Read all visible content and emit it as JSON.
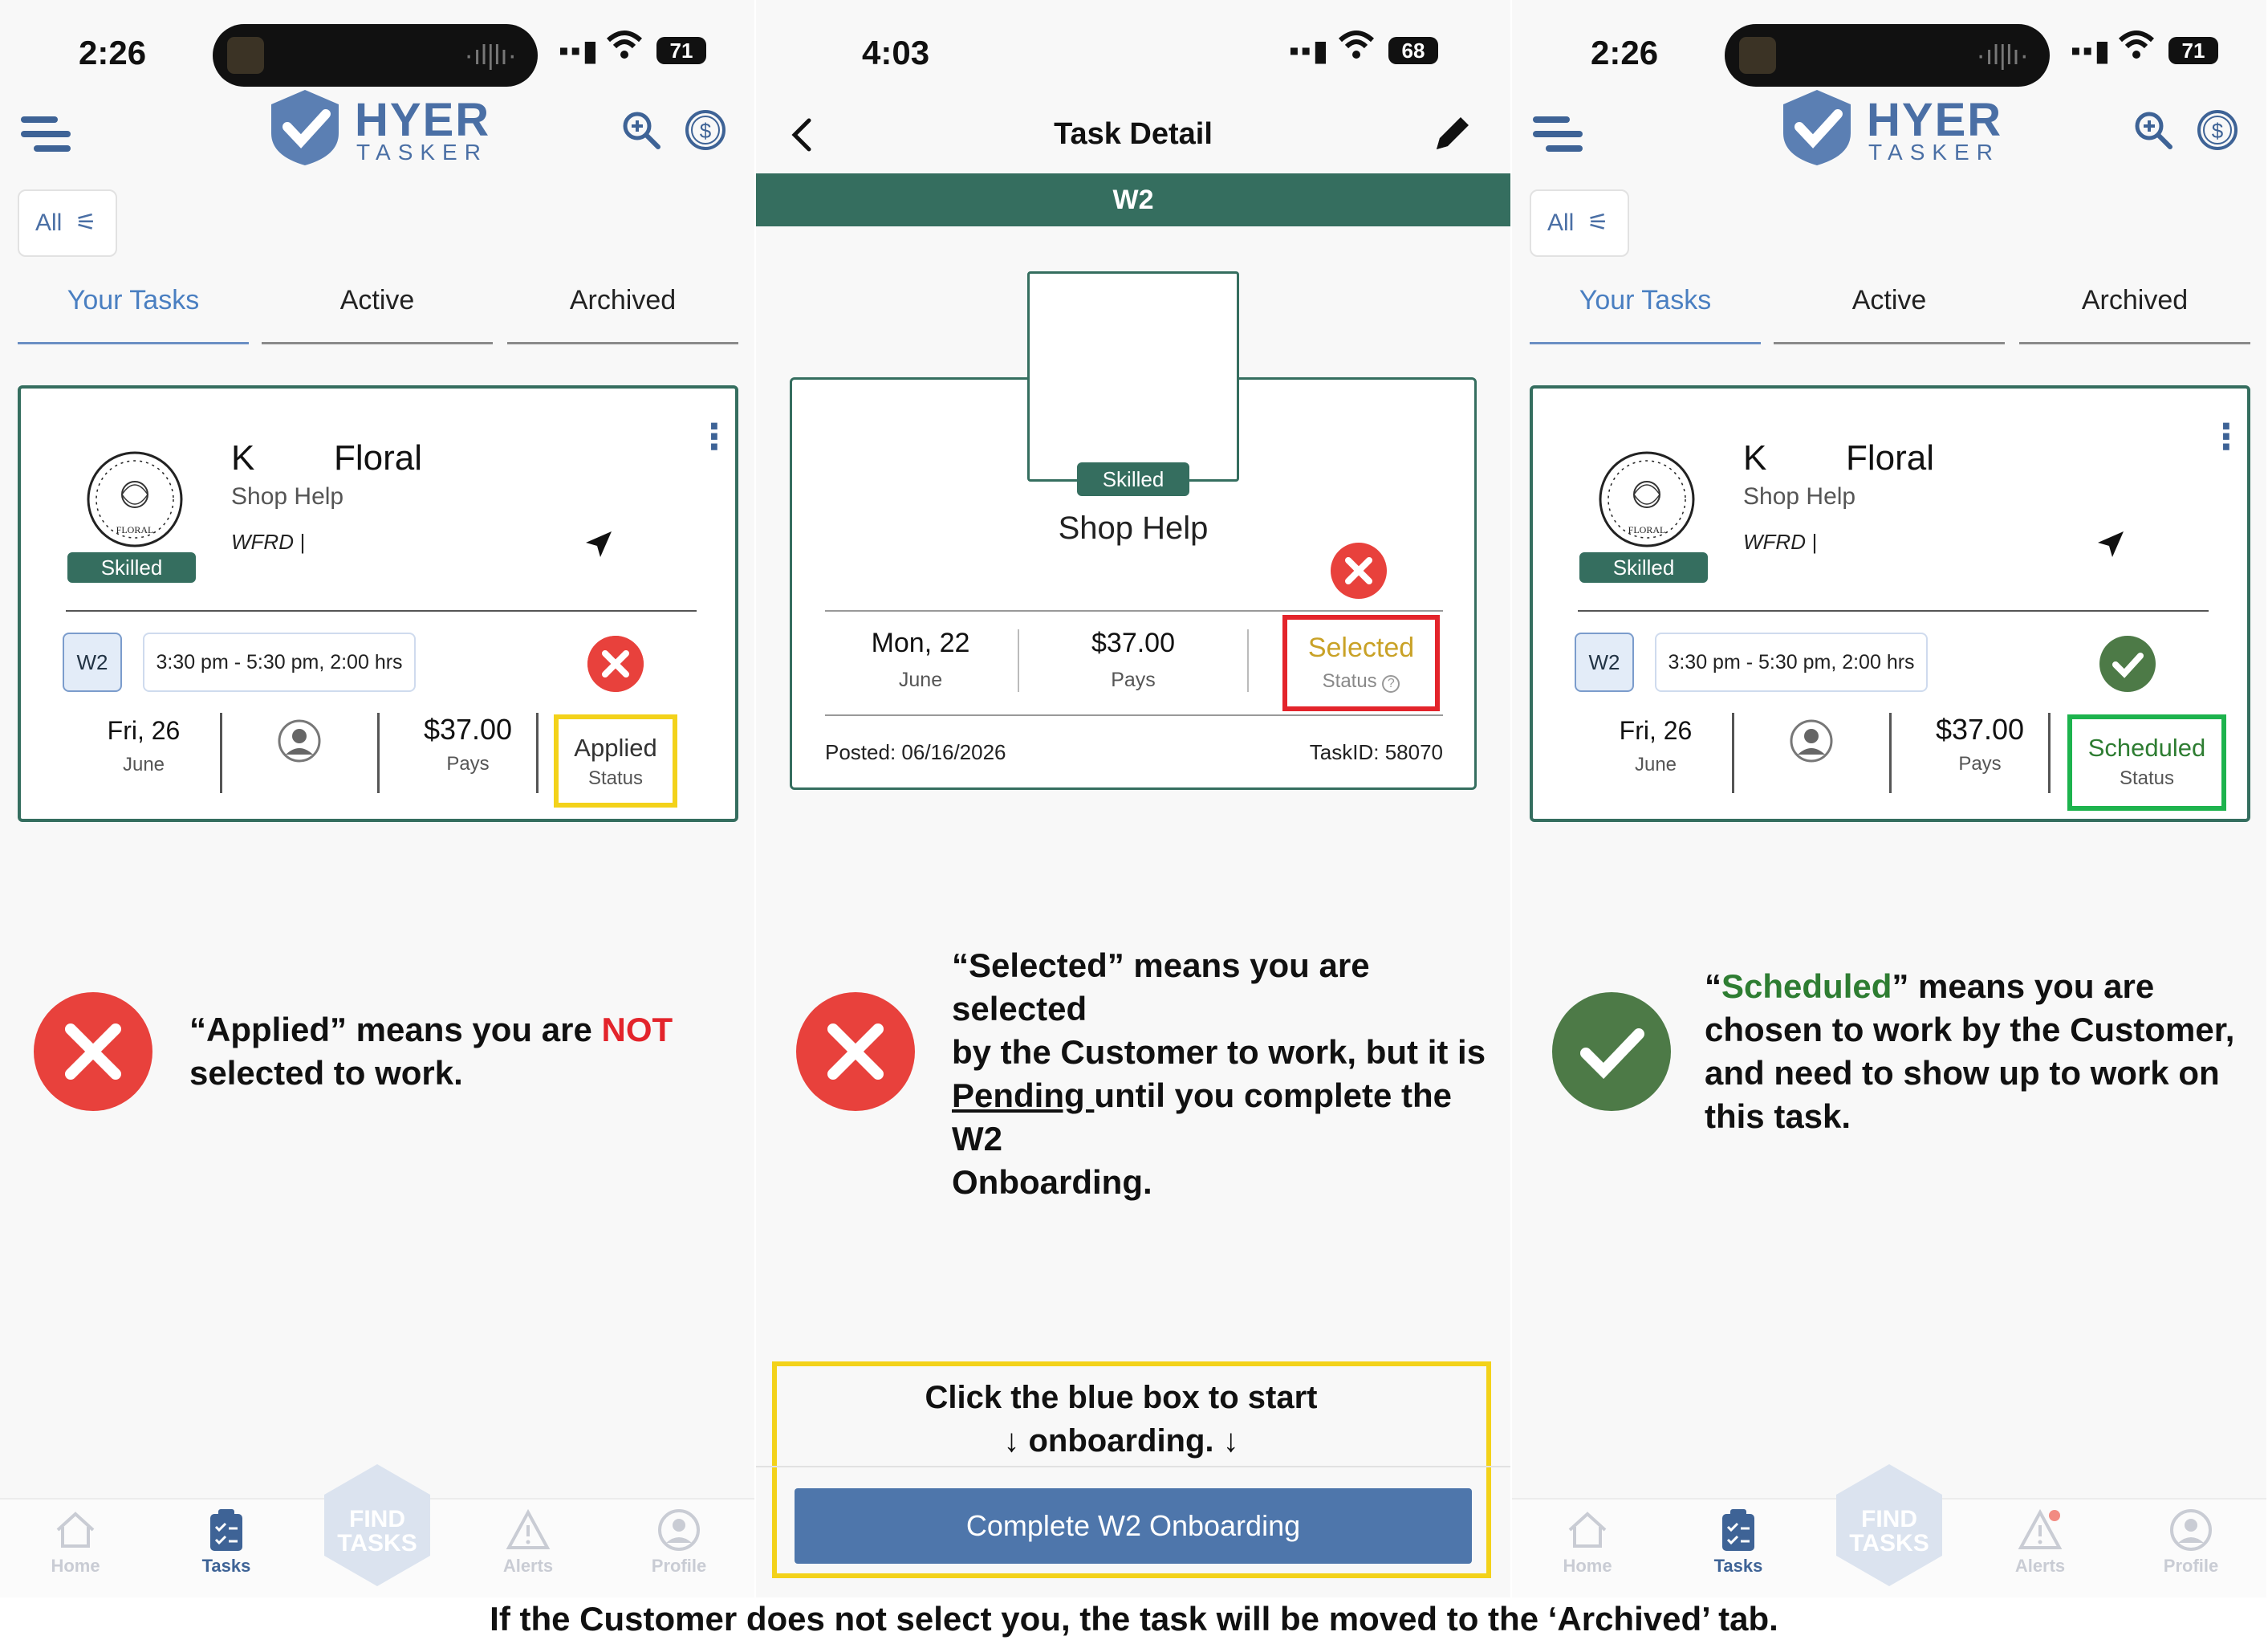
{
  "panel1": {
    "time": "2:26",
    "battery": "71",
    "logo_hyer": "HYER",
    "logo_tasker": "TASKER",
    "filter_label": "All",
    "tabs": [
      "Your Tasks",
      "Active",
      "Archived"
    ],
    "card": {
      "name_first": "K",
      "name_last": "Floral",
      "role": "Shop Help",
      "location": "WFRD |",
      "logo_text": "FLORAL",
      "skill_tag": "Skilled",
      "type": "W2",
      "time_range": "3:30 pm - 5:30 pm, 2:00 hrs",
      "date_main": "Fri, 26",
      "date_sub": "June",
      "pay_main": "$37.00",
      "pay_sub": "Pays",
      "status_main": "Applied",
      "status_sub": "Status"
    },
    "explain_prefix": "“Applied” means you are ",
    "explain_not": "NOT",
    "explain_line2": "selected to work.",
    "nav": [
      "Home",
      "Tasks",
      "Alerts",
      "Profile"
    ],
    "find_tasks": [
      "FIND",
      "TASKS"
    ]
  },
  "panel2": {
    "time": "4:03",
    "battery": "68",
    "title": "Task Detail",
    "banner": "W2",
    "skill_tag": "Skilled",
    "role": "Shop Help",
    "date_main": "Mon, 22",
    "date_sub": "June",
    "pay_main": "$37.00",
    "pay_sub": "Pays",
    "status_main": "Selected",
    "status_sub": "Status",
    "posted": "Posted: 06/16/2026",
    "task_id": "TaskID: 58070",
    "explain_lines": [
      "“Selected” means you are selected",
      "by the Customer to work, but it is"
    ],
    "explain_pending": "Pending ",
    "explain_line3_rest": "until you complete the W2",
    "explain_line4": "Onboarding.",
    "click_line1": "Click the blue box to start",
    "click_line2": "↓ onboarding. ↓",
    "onboard_button": "Complete W2 Onboarding"
  },
  "panel3": {
    "time": "2:26",
    "battery": "71",
    "logo_hyer": "HYER",
    "logo_tasker": "TASKER",
    "filter_label": "All",
    "tabs": [
      "Your Tasks",
      "Active",
      "Archived"
    ],
    "card": {
      "name_first": "K",
      "name_last": "Floral",
      "role": "Shop Help",
      "location": "WFRD |",
      "logo_text": "FLORAL",
      "skill_tag": "Skilled",
      "type": "W2",
      "time_range": "3:30 pm - 5:30 pm, 2:00 hrs",
      "date_main": "Fri, 26",
      "date_sub": "June",
      "pay_main": "$37.00",
      "pay_sub": "Pays",
      "status_main": "Scheduled",
      "status_sub": "Status"
    },
    "explain_open": "“",
    "explain_scheduled": "Scheduled",
    "explain_rest1": "” means you are",
    "explain_lines": [
      "chosen to work by the Customer,",
      "and need to show up to work on",
      "this task."
    ],
    "nav": [
      "Home",
      "Tasks",
      "Alerts",
      "Profile"
    ],
    "find_tasks": [
      "FIND",
      "TASKS"
    ]
  },
  "footer": "If the Customer does not select you, the task will be moved to the ‘Archived’ tab.",
  "colors": {
    "brand_blue": "#4a6fa5",
    "card_green": "#356e5f",
    "applied_yellow": "#f3d21a",
    "selected_red": "#e3242b",
    "scheduled_green": "#1db34d",
    "selected_gold": "#c9a227",
    "onboard_blue": "#4e76ab"
  }
}
